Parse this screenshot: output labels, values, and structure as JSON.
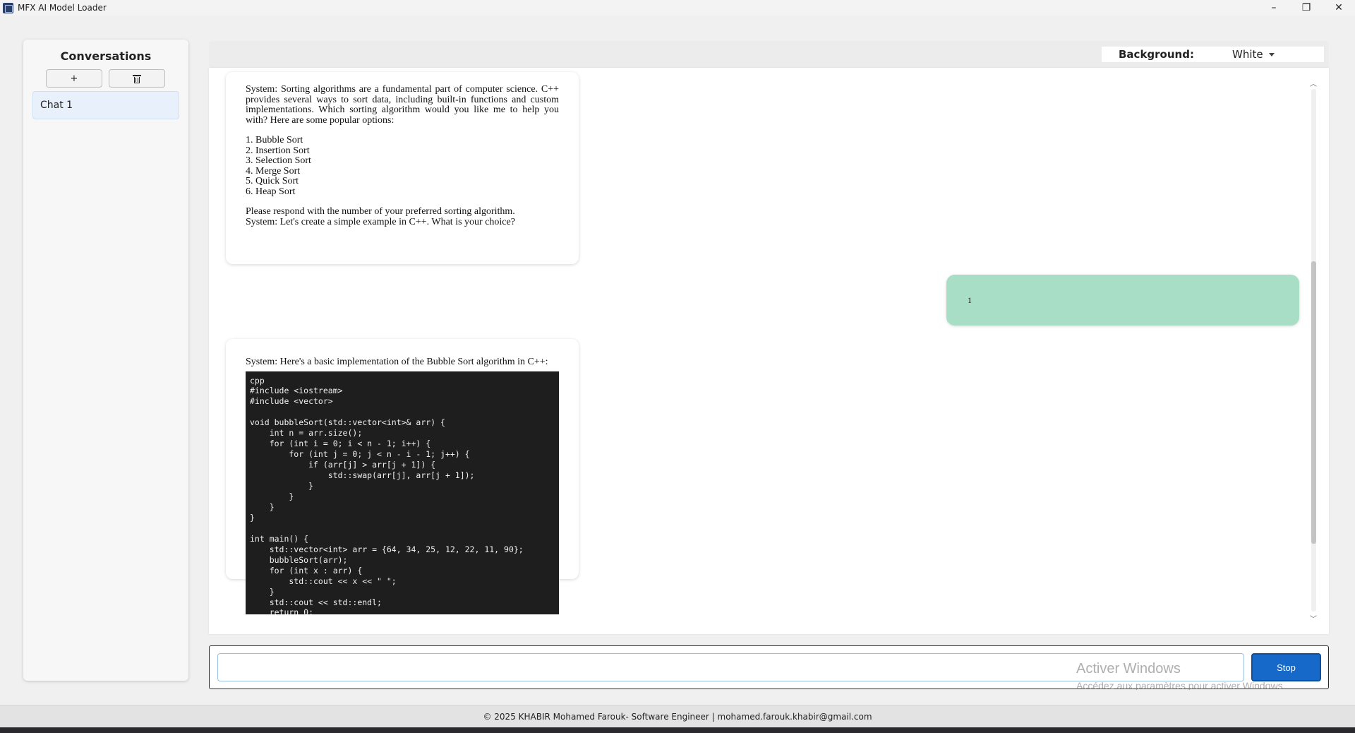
{
  "window": {
    "title": "MFX AI Model Loader",
    "controls": [
      "–",
      "❐",
      "✕"
    ]
  },
  "sidebar": {
    "title": "Conversations",
    "add_label": "+",
    "conversations": [
      {
        "label": "Chat 1",
        "selected": true
      }
    ]
  },
  "background": {
    "label": "Background:",
    "selected": "White"
  },
  "messages": [
    {
      "role": "system",
      "paragraphs": [
        "System: Sorting algorithms are a fundamental part of computer science. C++ provides several ways to sort data, including built-in functions and custom implementations. Which sorting algorithm would you like me to help you with? Here are some popular options:"
      ],
      "list": [
        "1. Bubble Sort",
        "2. Insertion Sort",
        "3. Selection Sort",
        "4. Merge Sort",
        "5. Quick Sort",
        "6. Heap Sort"
      ],
      "closing": [
        "Please respond with the number of your preferred sorting algorithm.",
        "System: Let's create a simple example in C++. What is your choice?"
      ]
    },
    {
      "role": "user",
      "text": "1"
    },
    {
      "role": "system",
      "intro": "System: Here's a basic implementation of the Bubble Sort algorithm in C++:",
      "code": "cpp\n#include <iostream>\n#include <vector>\n\nvoid bubbleSort(std::vector<int>& arr) {\n    int n = arr.size();\n    for (int i = 0; i < n - 1; i++) {\n        for (int j = 0; j < n - i - 1; j++) {\n            if (arr[j] > arr[j + 1]) {\n                std::swap(arr[j], arr[j + 1]);\n            }\n        }\n    }\n}\n\nint main() {\n    std::vector<int> arr = {64, 34, 25, 12, 22, 11, 90};\n    bubbleSort(arr);\n    for (int x : arr) {\n        std::cout << x << \" \";\n    }\n    std::cout << std::endl;\n    return 0;"
    }
  ],
  "input": {
    "value": "",
    "placeholder": "",
    "stop_label": "Stop"
  },
  "watermark": {
    "line1": "Activer Windows",
    "line2": "Accédez aux paramètres pour activer Windows."
  },
  "footer": {
    "text": "© 2025 KHABIR Mohamed Farouk- Software Engineer | mohamed.farouk.khabir@gmail.com"
  }
}
